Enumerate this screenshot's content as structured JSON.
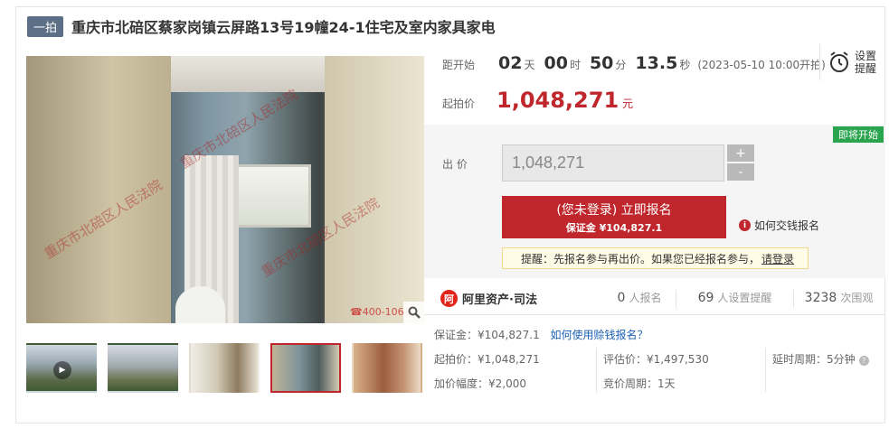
{
  "header": {
    "stage": "一拍",
    "title": "重庆市北碚区蔡家岗镇云屏路13号19幢24-1住宅及室内家具家电"
  },
  "gallery": {
    "watermark": "重庆市北碚区人民法院",
    "phone_watermark": "☎400-106-",
    "thumbnails": [
      "exterior-video",
      "exterior",
      "interior-kitchen",
      "bathroom",
      "bedroom"
    ]
  },
  "countdown": {
    "label": "距开始",
    "days": "02",
    "days_unit": "天",
    "hours": "00",
    "hours_unit": "时",
    "minutes": "50",
    "minutes_unit": "分",
    "seconds": "13.5",
    "seconds_unit": "秒",
    "start_note": "(2023-05-10 10:00开拍)"
  },
  "reminder": {
    "line1": "设置",
    "line2": "提醒"
  },
  "start_price": {
    "label": "起拍价",
    "value": "1,048,271",
    "unit": "元"
  },
  "bid": {
    "status_tag": "即将开始",
    "label": "出 价",
    "input_value": "1,048,271",
    "plus": "+",
    "minus": "-",
    "signup_line1": "(您未登录) 立即报名",
    "signup_line2": "保证金 ¥104,827.1",
    "howto": "如何交钱报名",
    "tip_text": "提醒：先报名参与再出价。如果您已经报名参与，",
    "tip_login": "请登录"
  },
  "stats": {
    "brand": "阿里资产·司法",
    "signups": "0",
    "signups_unit": "人报名",
    "reminders": "69",
    "reminders_unit": "人设置提醒",
    "views": "3238",
    "views_unit": "次围观"
  },
  "deposit": {
    "text": "保证金：¥104,827.1",
    "link": "如何使用赊钱报名？"
  },
  "details": {
    "start_price": "起拍价：¥1,048,271",
    "appraisal": "评估价：¥1,497,530",
    "delay": "延时周期：5分钟",
    "increment": "加价幅度：¥2,000",
    "bid_period": "竞价周期：1天"
  },
  "colors": {
    "accent": "#c0272d",
    "green": "#2aa44f",
    "link": "#1a5fb4"
  }
}
